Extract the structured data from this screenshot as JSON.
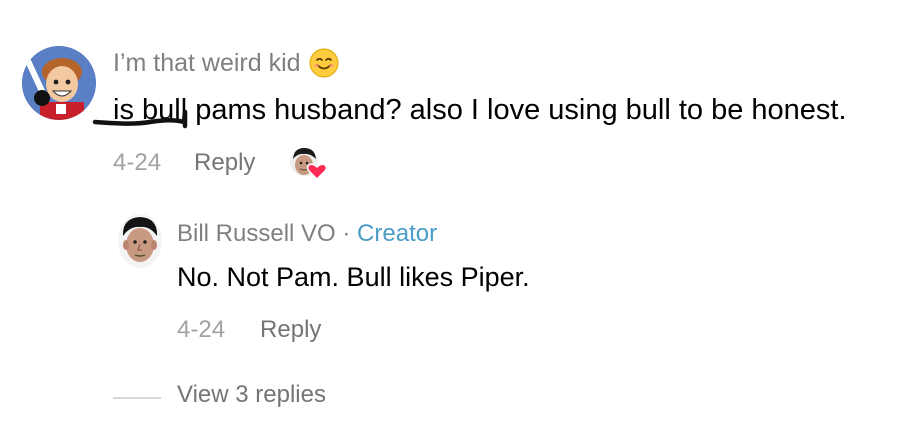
{
  "comment": {
    "username": "I’m that weird kid",
    "username_emoji": "smiling-face-emoji",
    "text_struck": "is bull",
    "text_rest": " pams husband? also I love using bull to be honest.",
    "date": "4-24",
    "reply_label": "Reply",
    "liked_by_creator": true
  },
  "reply": {
    "username": "Bill Russell VO",
    "separator": " · ",
    "creator_badge": "Creator",
    "text": "No. Not Pam. Bull likes Piper.",
    "date": "4-24",
    "reply_label": "Reply"
  },
  "view_replies_label": "View 3 replies",
  "colors": {
    "secondary_text": "#808080",
    "date": "#a2a2a2",
    "creator": "#4a9dc8",
    "heart": "#fe2c55"
  }
}
